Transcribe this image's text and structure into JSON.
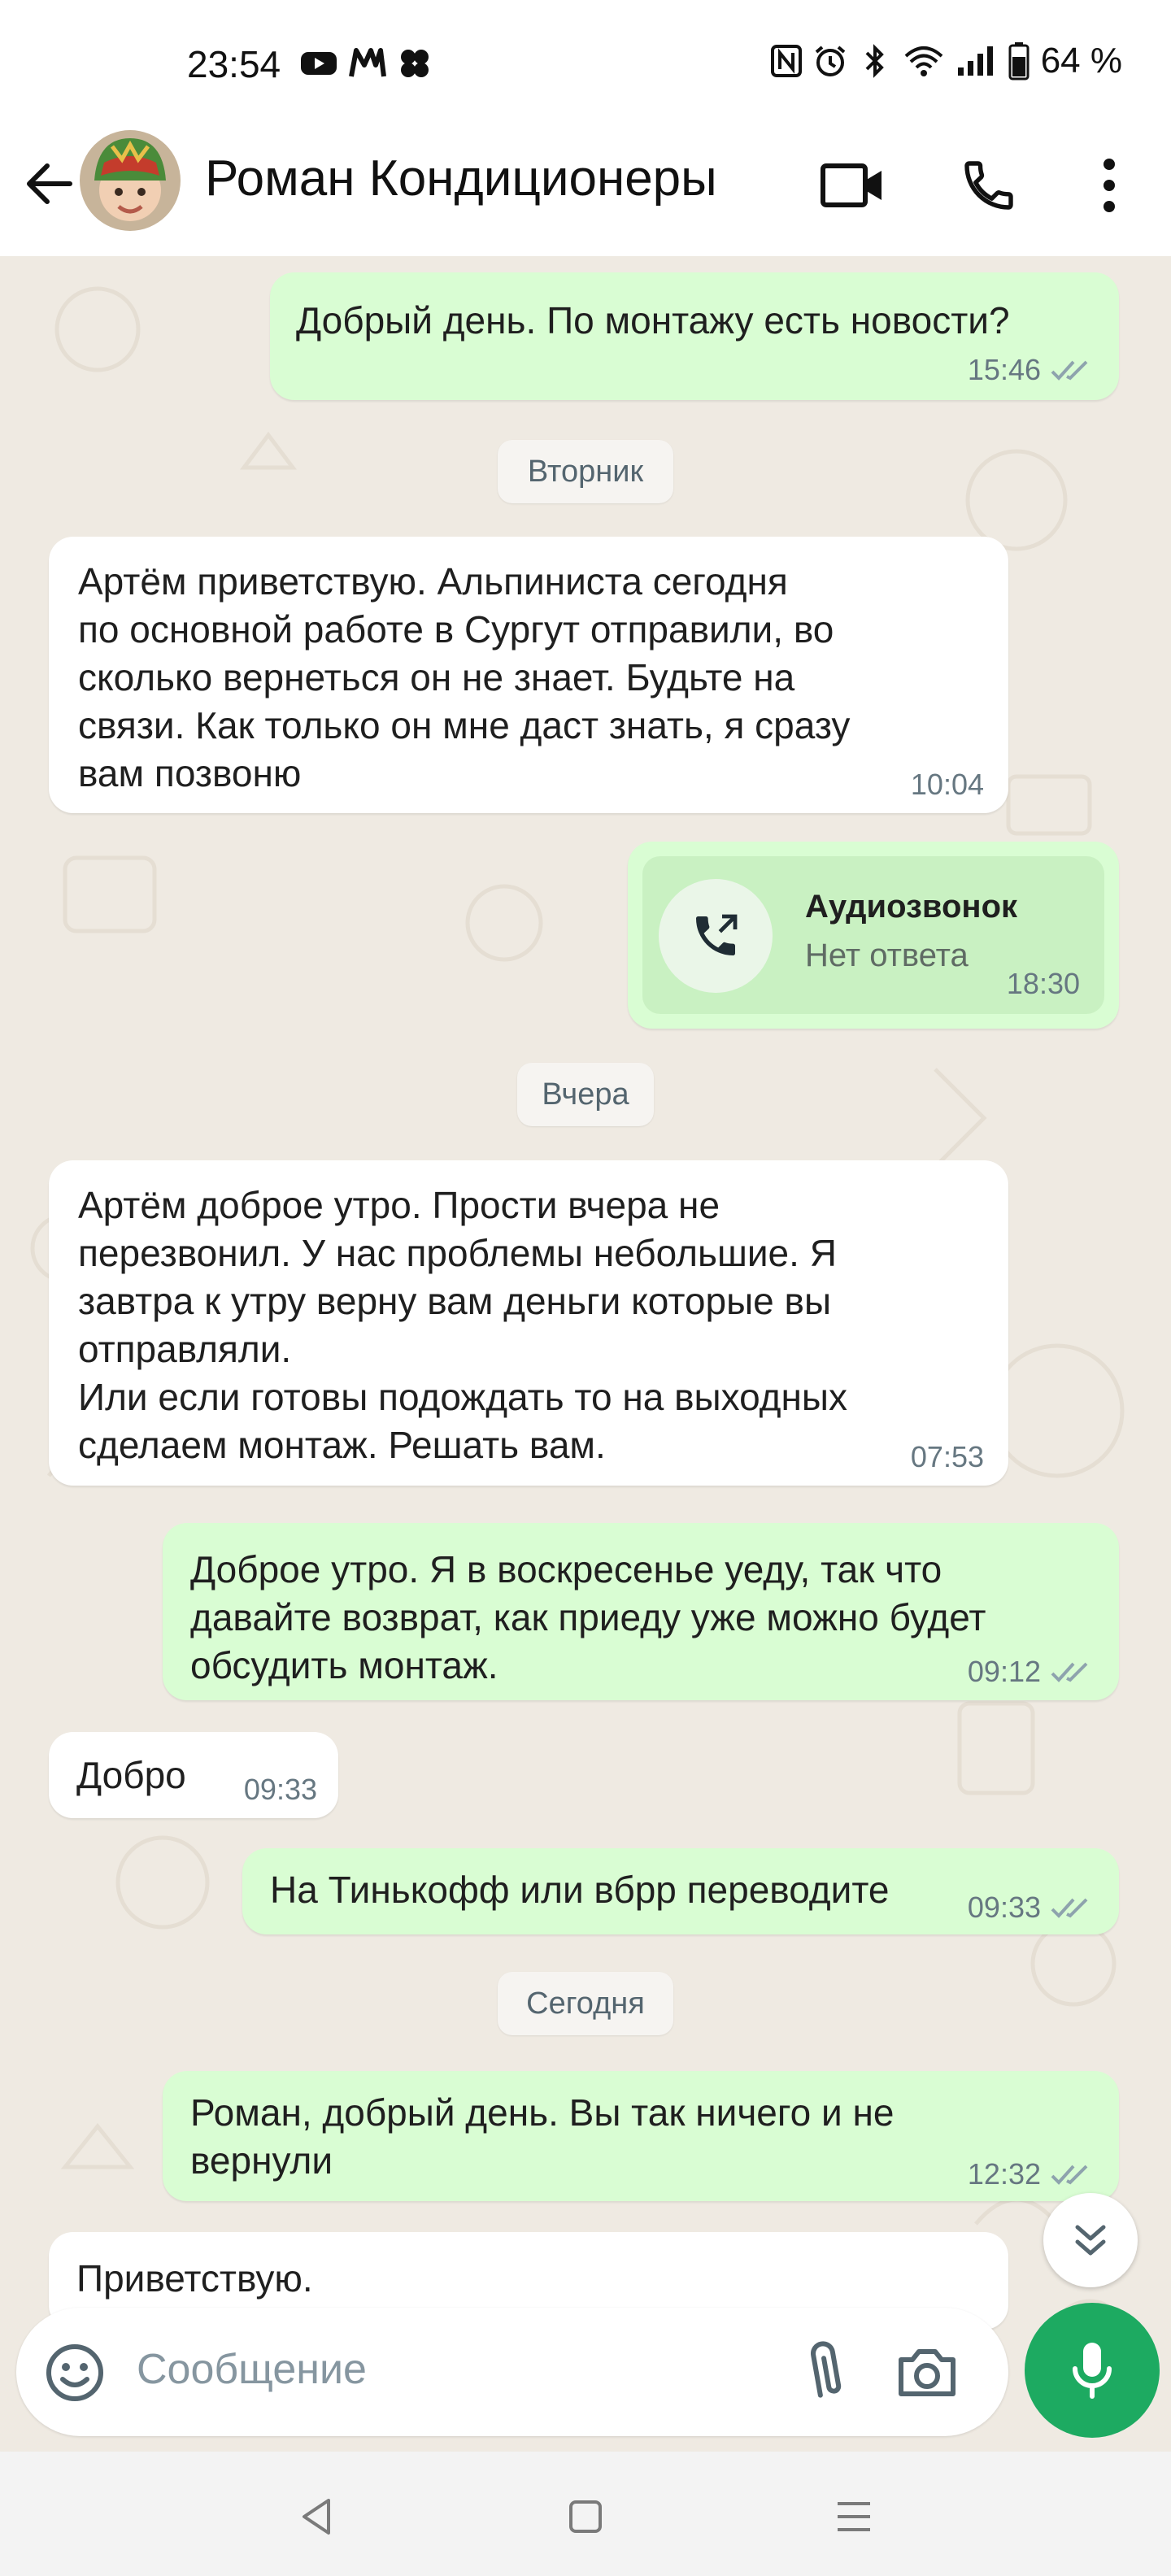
{
  "status_bar": {
    "time": "23:54",
    "battery": "64 %",
    "icons": [
      "youtube-icon",
      "mail-icon",
      "clover-icon",
      "nfc-icon",
      "alarm-icon",
      "bluetooth-icon",
      "wifi-icon",
      "signal-icon",
      "battery-icon"
    ]
  },
  "header": {
    "contact_name": "Роман Кондиционеры",
    "icons": [
      "back-arrow-icon",
      "video-call-icon",
      "phone-icon",
      "more-vert-icon"
    ]
  },
  "messages": [
    {
      "type": "out",
      "text": "Добрый день. По монтажу есть новости?",
      "time": "15:46",
      "ticks": "read"
    },
    {
      "type": "date",
      "text": "Вторник"
    },
    {
      "type": "in",
      "text": "Артём приветствую. Альпиниста сегодня\nпо основной работе в Сургут отправили, во\nсколько вернеться он не знает. Будьте на\nсвязи. Как только он мне даст знать, я сразу\nвам позвоню",
      "time": "10:04"
    },
    {
      "type": "call",
      "title": "Аудиозвонок",
      "subtitle": "Нет ответа",
      "time": "18:30"
    },
    {
      "type": "date",
      "text": "Вчера"
    },
    {
      "type": "in",
      "text": "Артём доброе утро. Прости вчера не\nперезвонил. У нас проблемы небольшие. Я\nзавтра к утру верну вам деньги которые вы\nотправляли.\nИли если готовы подождать то на выходных\nсделаем монтаж. Решать вам.",
      "time": "07:53"
    },
    {
      "type": "out",
      "text": "Доброе утро. Я в воскресенье уеду, так что\nдавайте возврат, как приеду уже можно будет\nобсудить монтаж.",
      "time": "09:12",
      "ticks": "read"
    },
    {
      "type": "in",
      "text": "Добро",
      "time": "09:33"
    },
    {
      "type": "out",
      "text": "На Тинькофф или вбрр переводите",
      "time": "09:33",
      "ticks": "read"
    },
    {
      "type": "date",
      "text": "Сегодня"
    },
    {
      "type": "out",
      "text": "Роман, добрый день. Вы так ничего и не\nвернули",
      "time": "12:32",
      "ticks": "read"
    },
    {
      "type": "in",
      "text": "Приветствую.",
      "time": ""
    }
  ],
  "input": {
    "placeholder": "Сообщение",
    "icons": [
      "emoji-icon",
      "attach-icon",
      "camera-icon",
      "mic-icon"
    ]
  },
  "nav": {
    "icons": [
      "nav-back-icon",
      "nav-home-icon",
      "nav-recents-icon"
    ]
  },
  "colors": {
    "chat_bg": "#efeae2",
    "outgoing_bubble": "#d9fdd3",
    "incoming_bubble": "#ffffff",
    "accent_green": "#1daa61",
    "meta_gray": "#667781",
    "read_ticks": "#8ea3ad"
  }
}
